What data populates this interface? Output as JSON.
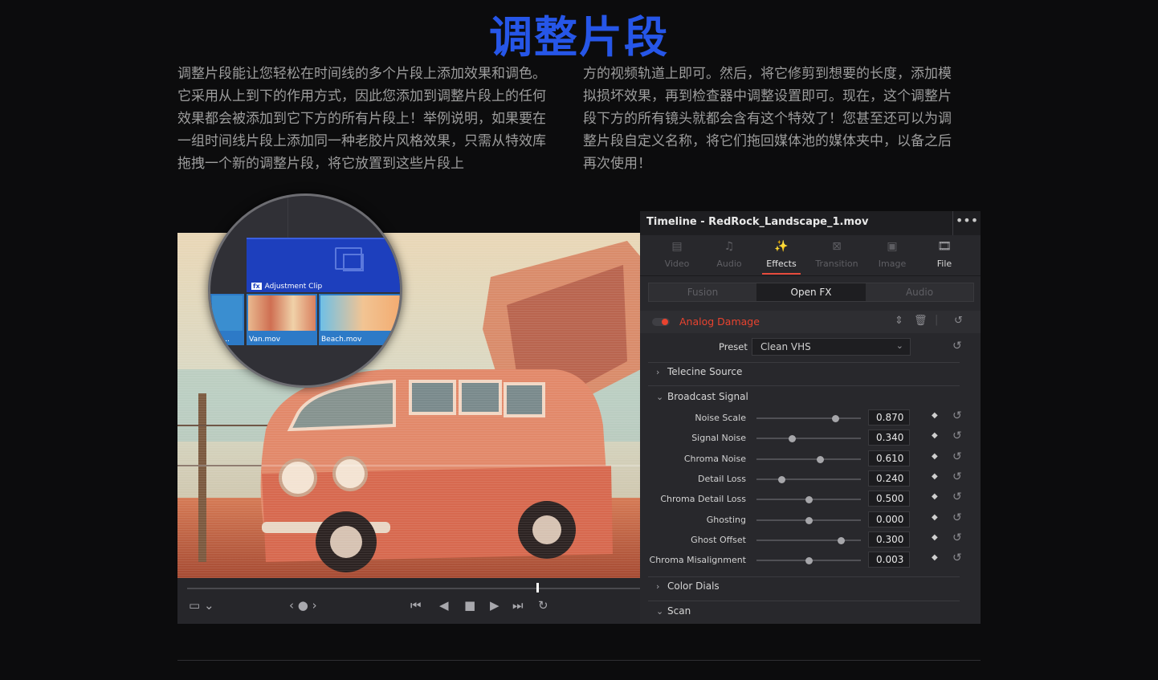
{
  "heading": "调整片段",
  "para_left": "调整片段能让您轻松在时间线的多个片段上添加效果和调色。它采用从上到下的作用方式，因此您添加到调整片段上的任何效果都会被添加到它下方的所有片段上！举例说明，如果要在一组时间线片段上添加同一种老胶片风格效果，只需从特效库拖拽一个新的调整片段，将它放置到这些片段上",
  "para_right": "方的视频轨道上即可。然后，将它修剪到想要的长度，添加模拟损坏效果，再到检查器中调整设置即可。现在，这个调整片段下方的所有镜头就都会含有这个特效了！您甚至还可以为调整片段自定义名称，将它们拖回媒体池的媒体夹中，以备之后再次使用！",
  "timeline": {
    "adjustment_clip": "Adjustment Clip",
    "fx_badge": "fx",
    "clip_left": "EN...",
    "clip_van": "Van.mov",
    "clip_beach": "Beach.mov"
  },
  "inspector": {
    "title": "Timeline - RedRock_Landscape_1.mov",
    "more": "•••",
    "tabs": [
      {
        "label": "Video",
        "icon": "video-icon"
      },
      {
        "label": "Audio",
        "icon": "audio-icon"
      },
      {
        "label": "Effects",
        "icon": "effects-icon"
      },
      {
        "label": "Transition",
        "icon": "transition-icon"
      },
      {
        "label": "Image",
        "icon": "image-icon"
      },
      {
        "label": "File",
        "icon": "file-icon"
      }
    ],
    "active_tab": "Effects",
    "subtabs": [
      "Fusion",
      "Open FX",
      "Audio"
    ],
    "active_subtab": "Open FX",
    "effect_name": "Analog Damage",
    "preset_label": "Preset",
    "preset_value": "Clean VHS",
    "sections": {
      "telecine": "Telecine Source",
      "broadcast": "Broadcast Signal",
      "color_dials": "Color Dials",
      "scan": "Scan"
    },
    "params": [
      {
        "label": "Noise Scale",
        "value": "0.870",
        "pos": 0.75
      },
      {
        "label": "Signal Noise",
        "value": "0.340",
        "pos": 0.34
      },
      {
        "label": "Chroma Noise",
        "value": "0.610",
        "pos": 0.61
      },
      {
        "label": "Detail Loss",
        "value": "0.240",
        "pos": 0.24
      },
      {
        "label": "Chroma Detail Loss",
        "value": "0.500",
        "pos": 0.5
      },
      {
        "label": "Ghosting",
        "value": "0.000",
        "pos": 0.5
      },
      {
        "label": "Ghost Offset",
        "value": "0.300",
        "pos": 0.81
      },
      {
        "label": "Chroma Misalignment",
        "value": "0.003",
        "pos": 0.5
      }
    ]
  },
  "accent_color": "#e8432f",
  "heading_color": "#2656e8"
}
